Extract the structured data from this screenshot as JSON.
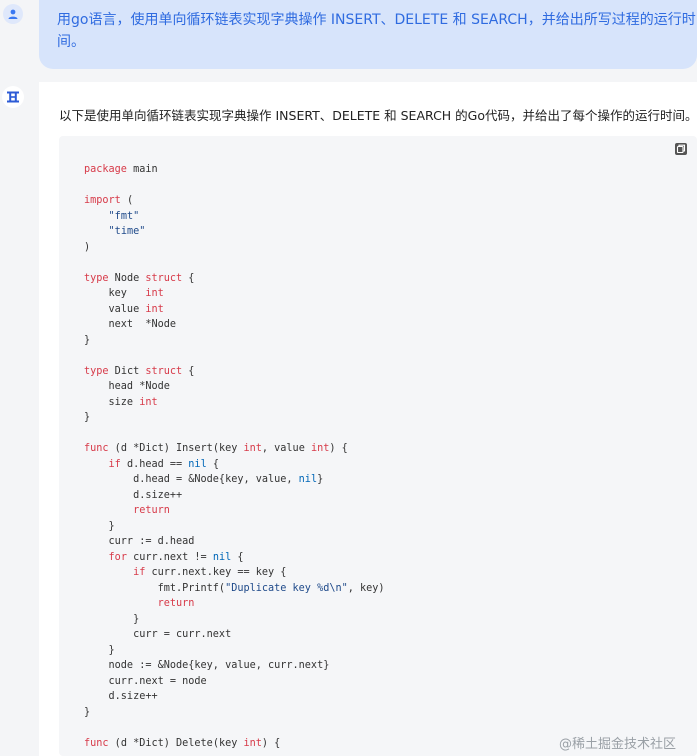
{
  "user": {
    "avatar_icon": "user-icon",
    "message": "用go语言，使用单向循环链表实现字典操作 INSERT、DELETE 和 SEARCH，并给出所写过程的运行时间。"
  },
  "assistant": {
    "avatar_icon": "logo-icon",
    "intro": "以下是使用单向循环链表实现字典操作 INSERT、DELETE 和 SEARCH 的Go代码，并给出了每个操作的运行时间。",
    "copy_icon": "copy-icon",
    "code_lines": [
      [
        {
          "t": "package",
          "c": "kw"
        },
        {
          "t": " main",
          "c": "plain"
        }
      ],
      [],
      [
        {
          "t": "import",
          "c": "kw"
        },
        {
          "t": " (",
          "c": "plain"
        }
      ],
      [
        {
          "t": "    ",
          "c": "plain"
        },
        {
          "t": "\"fmt\"",
          "c": "str"
        }
      ],
      [
        {
          "t": "    ",
          "c": "plain"
        },
        {
          "t": "\"time\"",
          "c": "str"
        }
      ],
      [
        {
          "t": ")",
          "c": "plain"
        }
      ],
      [],
      [
        {
          "t": "type",
          "c": "kw"
        },
        {
          "t": " Node ",
          "c": "plain"
        },
        {
          "t": "struct",
          "c": "kw"
        },
        {
          "t": " {",
          "c": "plain"
        }
      ],
      [
        {
          "t": "    key   ",
          "c": "plain"
        },
        {
          "t": "int",
          "c": "kw"
        }
      ],
      [
        {
          "t": "    value ",
          "c": "plain"
        },
        {
          "t": "int",
          "c": "kw"
        }
      ],
      [
        {
          "t": "    next  *Node",
          "c": "plain"
        }
      ],
      [
        {
          "t": "}",
          "c": "plain"
        }
      ],
      [],
      [
        {
          "t": "type",
          "c": "kw"
        },
        {
          "t": " Dict ",
          "c": "plain"
        },
        {
          "t": "struct",
          "c": "kw"
        },
        {
          "t": " {",
          "c": "plain"
        }
      ],
      [
        {
          "t": "    head *Node",
          "c": "plain"
        }
      ],
      [
        {
          "t": "    size ",
          "c": "plain"
        },
        {
          "t": "int",
          "c": "kw"
        }
      ],
      [
        {
          "t": "}",
          "c": "plain"
        }
      ],
      [],
      [
        {
          "t": "func",
          "c": "kw"
        },
        {
          "t": " (d *Dict) Insert(key ",
          "c": "plain"
        },
        {
          "t": "int",
          "c": "kw"
        },
        {
          "t": ", value ",
          "c": "plain"
        },
        {
          "t": "int",
          "c": "kw"
        },
        {
          "t": ") {",
          "c": "plain"
        }
      ],
      [
        {
          "t": "    ",
          "c": "plain"
        },
        {
          "t": "if",
          "c": "kw"
        },
        {
          "t": " d.head == ",
          "c": "plain"
        },
        {
          "t": "nil",
          "c": "lit"
        },
        {
          "t": " {",
          "c": "plain"
        }
      ],
      [
        {
          "t": "        d.head = &Node{key, value, ",
          "c": "plain"
        },
        {
          "t": "nil",
          "c": "lit"
        },
        {
          "t": "}",
          "c": "plain"
        }
      ],
      [
        {
          "t": "        d.size++",
          "c": "plain"
        }
      ],
      [
        {
          "t": "        ",
          "c": "plain"
        },
        {
          "t": "return",
          "c": "kw"
        }
      ],
      [
        {
          "t": "    }",
          "c": "plain"
        }
      ],
      [
        {
          "t": "    curr := d.head",
          "c": "plain"
        }
      ],
      [
        {
          "t": "    ",
          "c": "plain"
        },
        {
          "t": "for",
          "c": "kw"
        },
        {
          "t": " curr.next != ",
          "c": "plain"
        },
        {
          "t": "nil",
          "c": "lit"
        },
        {
          "t": " {",
          "c": "plain"
        }
      ],
      [
        {
          "t": "        ",
          "c": "plain"
        },
        {
          "t": "if",
          "c": "kw"
        },
        {
          "t": " curr.next.key == key {",
          "c": "plain"
        }
      ],
      [
        {
          "t": "            fmt.Printf(",
          "c": "plain"
        },
        {
          "t": "\"Duplicate key %d\\n\"",
          "c": "str"
        },
        {
          "t": ", key)",
          "c": "plain"
        }
      ],
      [
        {
          "t": "            ",
          "c": "plain"
        },
        {
          "t": "return",
          "c": "kw"
        }
      ],
      [
        {
          "t": "        }",
          "c": "plain"
        }
      ],
      [
        {
          "t": "        curr = curr.next",
          "c": "plain"
        }
      ],
      [
        {
          "t": "    }",
          "c": "plain"
        }
      ],
      [
        {
          "t": "    node := &Node{key, value, curr.next}",
          "c": "plain"
        }
      ],
      [
        {
          "t": "    curr.next = node",
          "c": "plain"
        }
      ],
      [
        {
          "t": "    d.size++",
          "c": "plain"
        }
      ],
      [
        {
          "t": "}",
          "c": "plain"
        }
      ],
      [],
      [
        {
          "t": "func",
          "c": "kw"
        },
        {
          "t": " (d *Dict) Delete(key ",
          "c": "plain"
        },
        {
          "t": "int",
          "c": "kw"
        },
        {
          "t": ") {",
          "c": "plain"
        }
      ]
    ]
  },
  "watermark": {
    "text": "@稀土掘金技术社区"
  },
  "colors": {
    "user_bubble": "#d7e4fb",
    "user_text": "#2f6be0",
    "code_bg": "#f5f6f8",
    "keyword": "#d73a49",
    "string": "#1f4a8a",
    "literal": "#0067b8"
  }
}
